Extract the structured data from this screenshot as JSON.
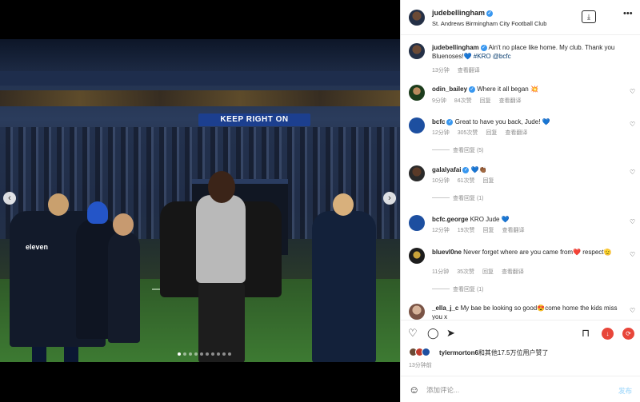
{
  "post": {
    "username": "judebellingham",
    "location": "St. Andrews Birmingham City Football Club",
    "caption_user": "judebellingham",
    "caption_text": "Ain't no place like home. My club. Thank you Bluenoses!💙",
    "caption_tags": "#KRO @bcfc",
    "caption_time": "13分钟",
    "caption_translate": "查看翻译"
  },
  "photo": {
    "banner_text": "KEEP RIGHT ON",
    "kit_logo": "eleven",
    "slide_count": 10,
    "active_slide": 0
  },
  "comments": [
    {
      "user": "odin_bailey",
      "text": "Where it all began 💥",
      "time": "9分钟",
      "likes": "84次赞",
      "reply": "回复",
      "translate": "查看翻译",
      "replies": ""
    },
    {
      "user": "bcfc",
      "text": "Great to have you back, Jude! 💙",
      "time": "12分钟",
      "likes": "305次赞",
      "reply": "回复",
      "translate": "查看翻译",
      "replies": "查看回复 (5)"
    },
    {
      "user": "galalyafai",
      "text": "💙👏🏾",
      "time": "10分钟",
      "likes": "61次赞",
      "reply": "回复",
      "translate": "",
      "replies": "查看回复 (1)"
    },
    {
      "user": "bcfc.george",
      "text": "KRO Jude 💙",
      "time": "12分钟",
      "likes": "19次赞",
      "reply": "回复",
      "translate": "查看翻译",
      "replies": ""
    },
    {
      "user": "bluevl0ne",
      "text": "Never forget where are you came from❤️ respect🫡",
      "time": "11分钟",
      "likes": "35次赞",
      "reply": "回复",
      "translate": "查看翻译",
      "replies": "查看回复 (1)"
    },
    {
      "user": "_ella_j_c",
      "text": "My bae be looking so good😍come home the kids miss you x",
      "time": "",
      "likes": "",
      "reply": "",
      "translate": "",
      "replies": ""
    }
  ],
  "actions": {
    "like_icon": "heart-icon",
    "comment_icon": "comment-icon",
    "share_icon": "share-icon",
    "save_icon": "bookmark-icon"
  },
  "likes": {
    "first_user": "tylermorton6",
    "rest": "和其他17.5万位用户赞了"
  },
  "post_time": "13分钟前",
  "composer": {
    "placeholder": "添加评论...",
    "post_label": "发布"
  },
  "colors": {
    "verified": "#3897f0",
    "link": "#00376b",
    "muted": "#8e8e8e",
    "accent_red": "#e8463a"
  }
}
